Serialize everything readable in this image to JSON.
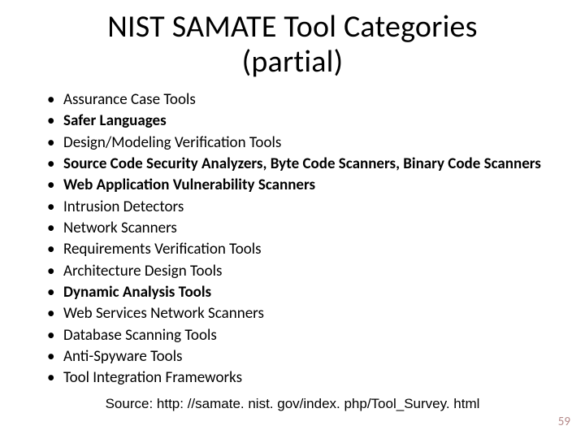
{
  "title_line1": "NIST SAMATE Tool Categories",
  "title_line2": "(partial)",
  "bullets": [
    {
      "text": "Assurance Case Tools",
      "bold": false
    },
    {
      "text": "Safer Languages",
      "bold": true
    },
    {
      "text": "Design/Modeling Verification Tools",
      "bold": false
    },
    {
      "text": "Source Code Security Analyzers, Byte Code Scanners, Binary Code Scanners",
      "bold": true
    },
    {
      "text": "Web Application Vulnerability Scanners",
      "bold": true
    },
    {
      "text": "Intrusion Detectors",
      "bold": false
    },
    {
      "text": "Network Scanners",
      "bold": false
    },
    {
      "text": "Requirements Verification Tools",
      "bold": false
    },
    {
      "text": "Architecture Design Tools",
      "bold": false
    },
    {
      "text": "Dynamic Analysis Tools",
      "bold": true
    },
    {
      "text": "Web Services Network Scanners",
      "bold": false
    },
    {
      "text": "Database Scanning Tools",
      "bold": false
    },
    {
      "text": "Anti-Spyware Tools",
      "bold": false
    },
    {
      "text": "Tool Integration Frameworks",
      "bold": false
    }
  ],
  "source": "Source: http: //samate. nist. gov/index. php/Tool_Survey. html",
  "page_number": "59"
}
